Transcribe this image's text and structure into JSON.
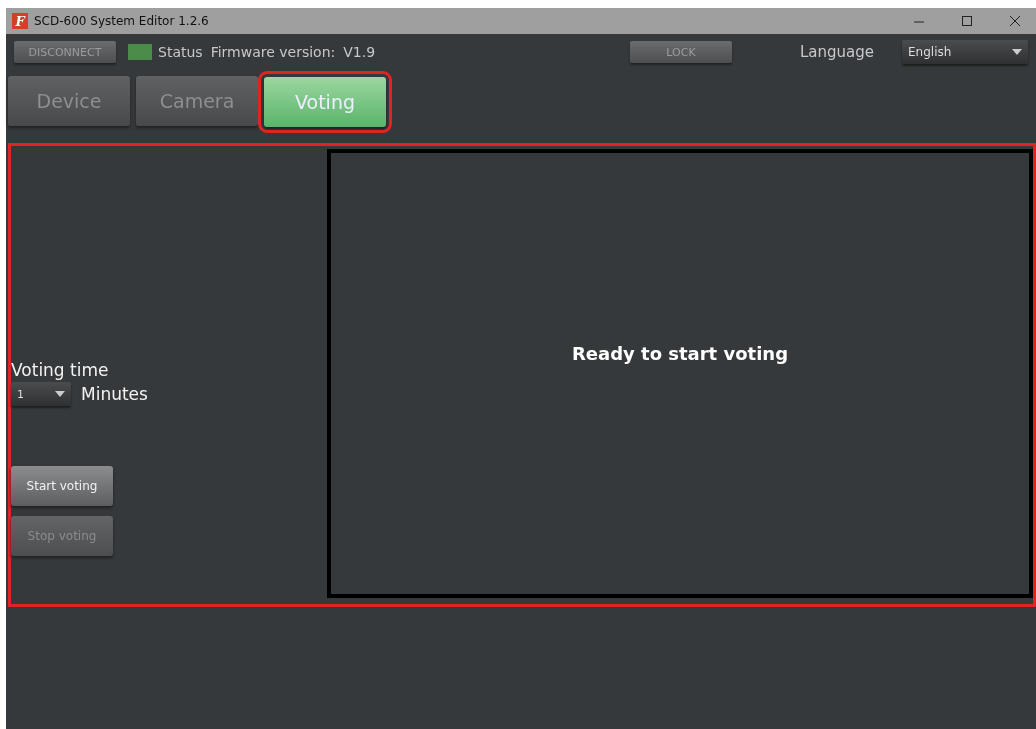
{
  "window": {
    "title": "SCD-600 System Editor 1.2.6",
    "app_icon": "F"
  },
  "toolbar": {
    "disconnect": "DISCONNECT",
    "status": {
      "label": "Status",
      "color": "#4c8c4a"
    },
    "firmware_label": "Firmware version:",
    "firmware_value": "V1.9",
    "lock": "LOCK",
    "language_label": "Language",
    "language_value": "English"
  },
  "tabs": [
    {
      "label": "Device",
      "selected": false
    },
    {
      "label": "Camera",
      "selected": false
    },
    {
      "label": "Voting",
      "selected": true
    }
  ],
  "voting": {
    "time_label": "Voting time",
    "time_value": "1",
    "unit": "Minutes",
    "buttons": [
      {
        "label": "Start voting",
        "disabled": false
      },
      {
        "label": "Stop voting",
        "disabled": true
      }
    ],
    "message": "Ready to start voting"
  }
}
